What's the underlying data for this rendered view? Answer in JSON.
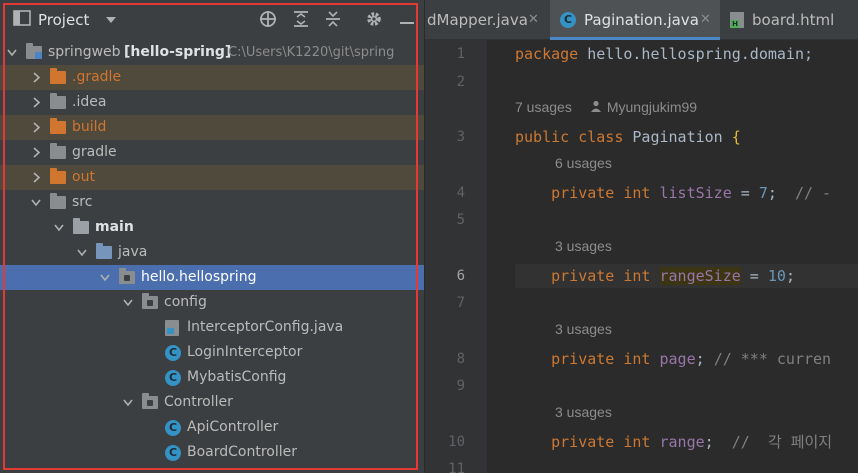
{
  "project_panel": {
    "title": "Project",
    "tree": [
      {
        "label": "springweb",
        "bold_suffix": "[hello-spring]",
        "path": "C:\\Users\\K1220\\git\\spring",
        "level": 0,
        "chevron": "down",
        "icon": "module-folder-icon"
      },
      {
        "label": ".gradle",
        "level": 1,
        "chevron": "right",
        "icon": "folder-icon",
        "style": "excluded"
      },
      {
        "label": ".idea",
        "level": 1,
        "chevron": "right",
        "icon": "folder-icon",
        "style": "normal"
      },
      {
        "label": "build",
        "level": 1,
        "chevron": "right",
        "icon": "folder-icon",
        "style": "excluded"
      },
      {
        "label": "gradle",
        "level": 1,
        "chevron": "right",
        "icon": "folder-icon",
        "style": "normal"
      },
      {
        "label": "out",
        "level": 1,
        "chevron": "right",
        "icon": "folder-icon",
        "style": "excluded"
      },
      {
        "label": "src",
        "level": 1,
        "chevron": "down",
        "icon": "folder-icon",
        "style": "normal"
      },
      {
        "label": "main",
        "level": 2,
        "chevron": "down",
        "icon": "source-root-folder-icon",
        "style": "bold"
      },
      {
        "label": "java",
        "level": 3,
        "chevron": "down",
        "icon": "java-source-folder-icon",
        "style": "normal"
      },
      {
        "label": "hello.hellospring",
        "level": 4,
        "chevron": "down",
        "icon": "package-icon",
        "style": "selected"
      },
      {
        "label": "config",
        "level": 5,
        "chevron": "down",
        "icon": "package-icon",
        "style": "normal"
      },
      {
        "label": "InterceptorConfig.java",
        "level": 6,
        "chevron": "",
        "icon": "java-file-icon",
        "style": "normal"
      },
      {
        "label": "LoginInterceptor",
        "level": 6,
        "chevron": "",
        "icon": "class-icon",
        "style": "normal"
      },
      {
        "label": "MybatisConfig",
        "level": 6,
        "chevron": "",
        "icon": "class-icon",
        "style": "normal"
      },
      {
        "label": "Controller",
        "level": 5,
        "chevron": "down",
        "icon": "package-icon",
        "style": "normal"
      },
      {
        "label": "ApiController",
        "level": 6,
        "chevron": "",
        "icon": "class-icon",
        "style": "normal"
      },
      {
        "label": "BoardController",
        "level": 6,
        "chevron": "",
        "icon": "class-icon",
        "style": "normal"
      }
    ]
  },
  "editor": {
    "tabs": [
      {
        "label": "dMapper.java",
        "active": false,
        "icon": ""
      },
      {
        "label": "Pagination.java",
        "active": true,
        "icon": "class-icon"
      },
      {
        "label": "board.html",
        "active": false,
        "icon": "html-file-icon"
      }
    ],
    "close_glyph": "✕",
    "lines": [
      {
        "n": "1",
        "code": [
          [
            "kw",
            "package "
          ],
          [
            "cls",
            "hello.hellospring.domain;"
          ]
        ]
      },
      {
        "n": "2",
        "code": []
      },
      {
        "n": "3",
        "hint": "7 usages",
        "author": "Myungjukim99",
        "code": [
          [
            "kw",
            "public class "
          ],
          [
            "cls",
            "Pagination "
          ],
          [
            "brace",
            "{"
          ]
        ]
      },
      {
        "n": "4",
        "hint": "6 usages",
        "code": [
          [
            "kw",
            "    private int "
          ],
          [
            "fld",
            "listSize"
          ],
          [
            "cls",
            " = "
          ],
          [
            "num",
            "7"
          ],
          [
            "cls",
            ";  "
          ],
          [
            "cmt",
            "// -"
          ]
        ]
      },
      {
        "n": "5",
        "code": []
      },
      {
        "n": "6",
        "hint": "3 usages",
        "current": true,
        "code": [
          [
            "kw",
            "    private int "
          ],
          [
            "fldhl",
            "rangeSize"
          ],
          [
            "cls",
            " = "
          ],
          [
            "num",
            "10"
          ],
          [
            "cls",
            ";"
          ]
        ]
      },
      {
        "n": "7",
        "code": []
      },
      {
        "n": "8",
        "hint": "3 usages",
        "code": [
          [
            "kw",
            "    private int "
          ],
          [
            "fld",
            "page"
          ],
          [
            "cls",
            "; "
          ],
          [
            "cmt",
            "// *** curren"
          ]
        ]
      },
      {
        "n": "9",
        "code": []
      },
      {
        "n": "10",
        "hint": "3 usages",
        "code": [
          [
            "kw",
            "    private int "
          ],
          [
            "fld",
            "range"
          ],
          [
            "cls",
            ";  "
          ],
          [
            "cmt",
            "//  각 페이지"
          ]
        ]
      },
      {
        "n": "11",
        "code": []
      }
    ]
  }
}
